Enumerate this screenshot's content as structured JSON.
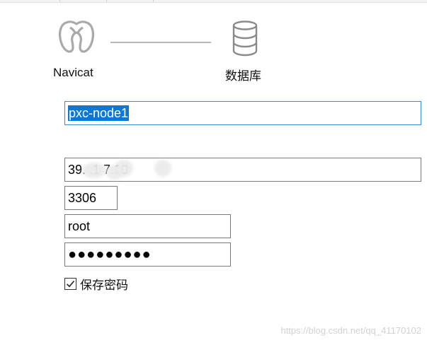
{
  "diagram": {
    "source_label": "Navicat",
    "target_label": "数据库"
  },
  "form": {
    "connection_name": "pxc-node1",
    "host": "39.  .1  7.10",
    "port": "3306",
    "username": "root",
    "password_mask": "●●●●●●●●●",
    "save_password_label": "保存密码",
    "save_password_checked": true
  },
  "watermark": "https://blog.csdn.net/qq_41170102",
  "icons": {
    "source": "navicat-logo-icon",
    "target": "database-icon",
    "check": "checkmark-icon"
  }
}
